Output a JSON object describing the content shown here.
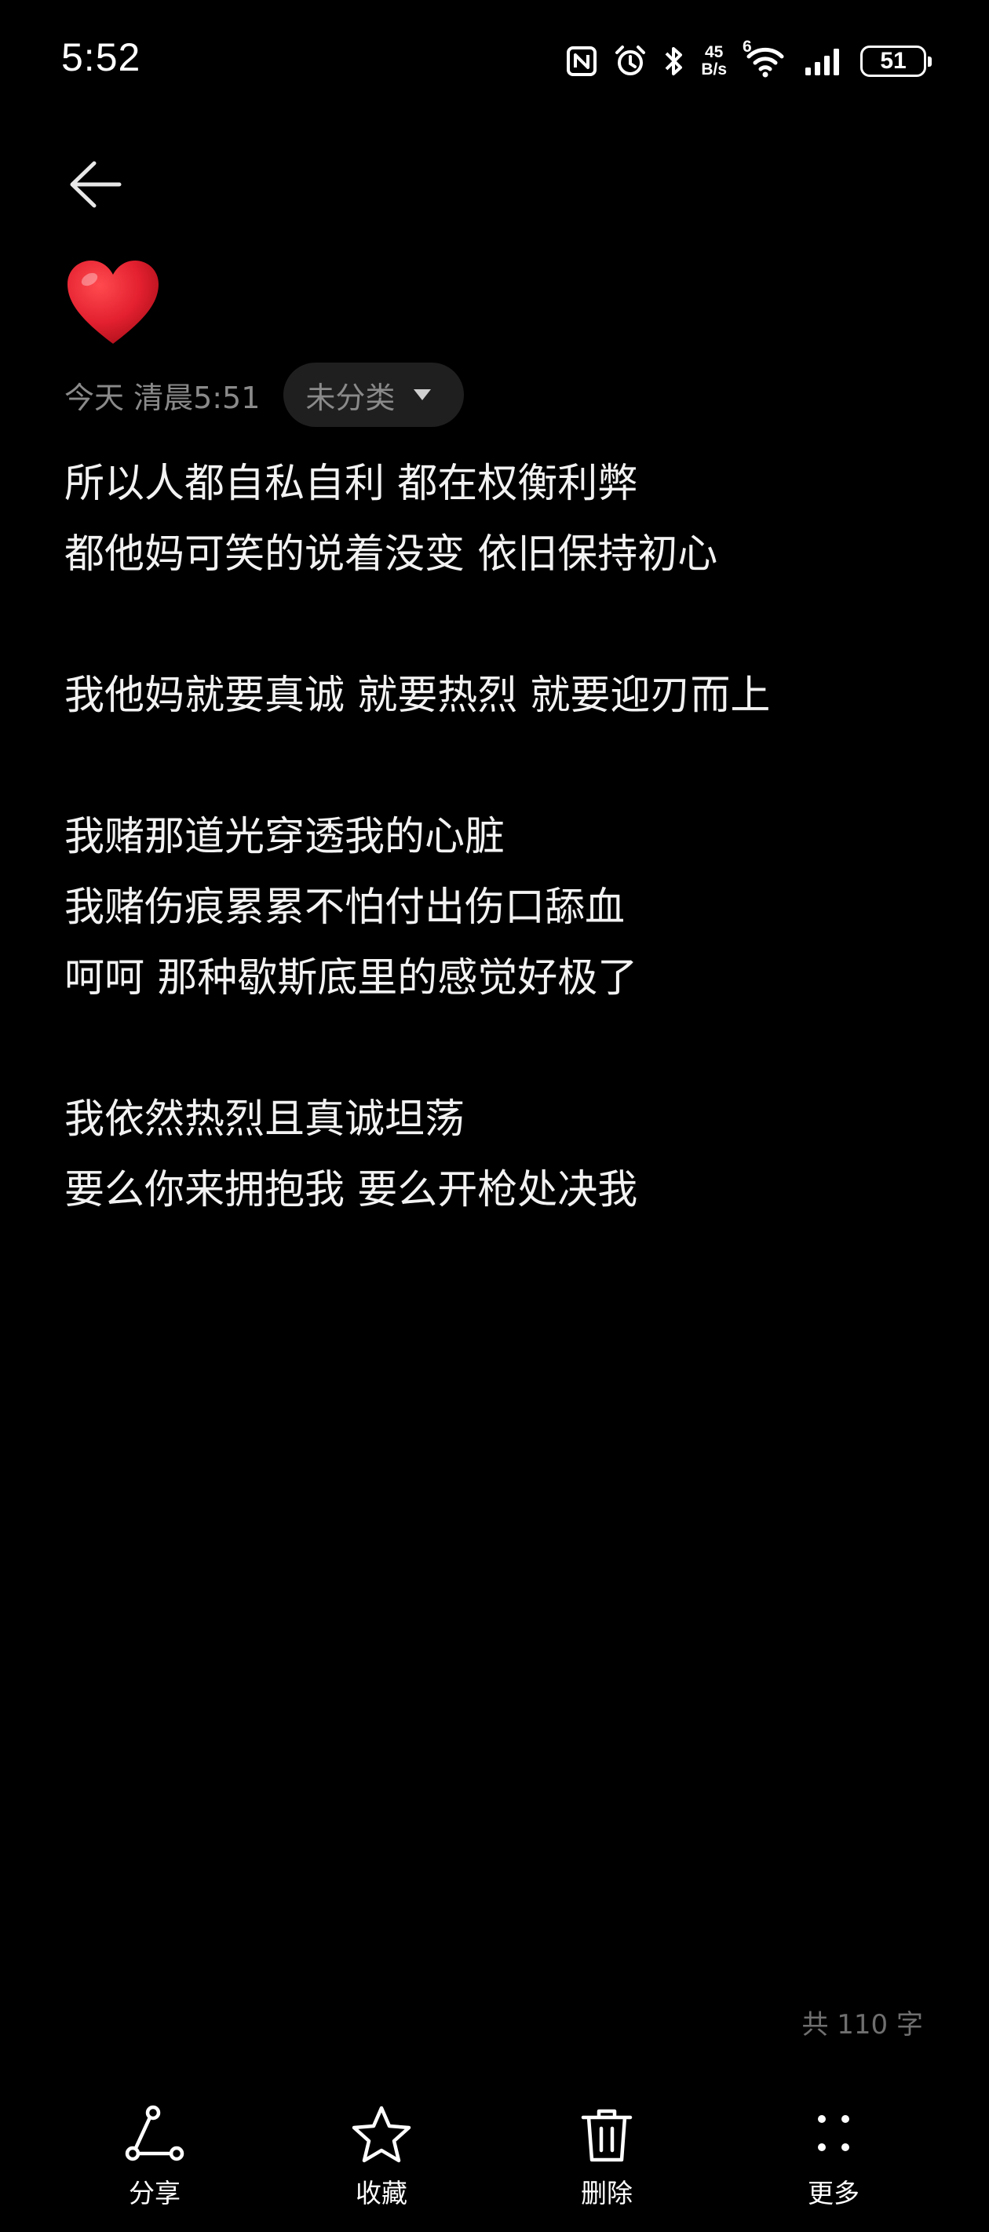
{
  "status_bar": {
    "time": "5:52",
    "net_speed_value": "45",
    "net_speed_unit": "B/s",
    "wifi_badge": "6",
    "battery_level": "51"
  },
  "note": {
    "emoji": "❤️",
    "date": "今天 清晨5:51",
    "category": "未分类",
    "lines": [
      "所以人都自私自利 都在权衡利弊",
      "都他妈可笑的说着没变 依旧保持初心",
      "",
      "我他妈就要真诚 就要热烈 就要迎刃而上",
      "",
      "我赌那道光穿透我的心脏",
      "我赌伤痕累累不怕付出伤口舔血",
      "呵呵 那种歇斯底里的感觉好极了",
      "",
      "我依然热烈且真诚坦荡",
      "要么你来拥抱我 要么开枪处决我"
    ],
    "word_count": "共 110 字"
  },
  "toolbar": {
    "share": "分享",
    "favorite": "收藏",
    "delete": "删除",
    "more": "更多"
  },
  "colors": {
    "background": "#000000",
    "text": "#f2f2f2",
    "muted": "#8a8a8a",
    "chip_bg": "#1f1f1f",
    "heart": "#e3202f"
  }
}
